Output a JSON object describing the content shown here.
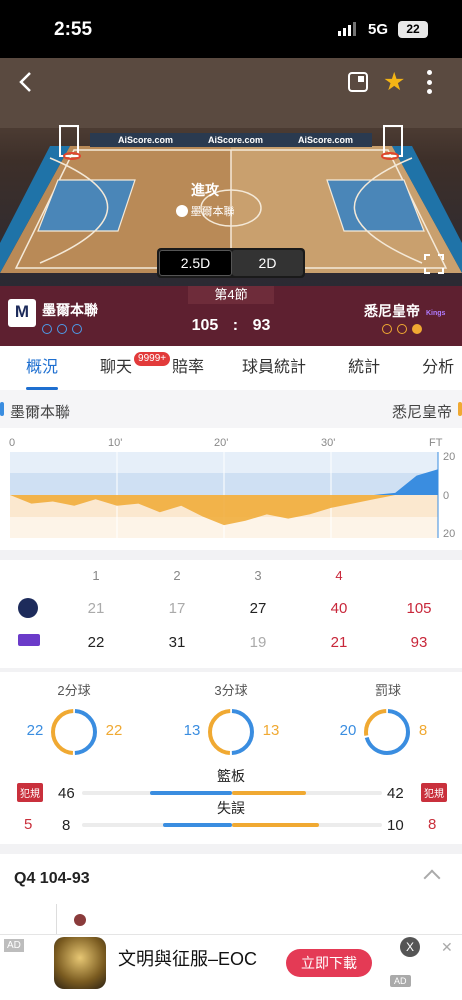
{
  "status_bar": {
    "time": "2:55",
    "network": "5G",
    "battery": "22"
  },
  "header": {
    "back_icon": "chevron-left-icon",
    "window_icon": "picture-in-picture-icon",
    "favorite_icon": "star-icon",
    "more_icon": "more-vertical-icon",
    "banner_text": [
      "AiScore.com",
      "AiScore.com",
      "AiScore.com"
    ],
    "possession_label": "進攻",
    "possession_team": "墨爾本聯",
    "view_modes": [
      "2.5D",
      "2D"
    ],
    "active_view": "2.5D",
    "fullscreen_icon": "fullscreen-icon"
  },
  "scoreboard": {
    "period": "第4節",
    "home": {
      "name": "墨爾本聯",
      "logo_text": "M",
      "score": "105",
      "timeouts": [
        "empty",
        "empty",
        "empty"
      ]
    },
    "away": {
      "name": "悉尼皇帝",
      "logo_text": "Kings",
      "score": "93",
      "timeouts": [
        "filled",
        "filled",
        "filled"
      ]
    },
    "separator": ":"
  },
  "tabs": [
    {
      "label": "概況",
      "active": true
    },
    {
      "label": "聊天",
      "badge": "9999+"
    },
    {
      "label": "賠率"
    },
    {
      "label": "球員統計"
    },
    {
      "label": "統計"
    },
    {
      "label": "分析"
    }
  ],
  "momentum": {
    "home_label": "墨爾本聯",
    "away_label": "悉尼皇帝",
    "x_labels": [
      "0",
      "10'",
      "20'",
      "30'",
      "FT"
    ],
    "y_labels": [
      "20",
      "0",
      "20"
    ],
    "colors": {
      "home": "#3a8de0",
      "away": "#f0a932"
    }
  },
  "chart_data": {
    "type": "area",
    "x": [
      0,
      2,
      4,
      6,
      8,
      10,
      12,
      14,
      16,
      18,
      20,
      22,
      24,
      26,
      28,
      30,
      32,
      34,
      36,
      38,
      40
    ],
    "values": [
      0,
      -4,
      -3,
      -5,
      -2,
      -5,
      -4,
      -8,
      -5,
      -10,
      -14,
      -12,
      -9,
      -11,
      -9,
      -6,
      -4,
      -2,
      1,
      9,
      12
    ],
    "xlim": [
      0,
      40
    ],
    "ylim": [
      -20,
      20
    ]
  },
  "quarters": {
    "headers": [
      "1",
      "2",
      "3",
      "4"
    ],
    "home": {
      "q": [
        "21",
        "17",
        "27",
        "40"
      ],
      "total": "105"
    },
    "away": {
      "q": [
        "22",
        "31",
        "19",
        "21"
      ],
      "total": "93"
    }
  },
  "shooting": [
    {
      "title": "2分球",
      "home": "22",
      "away": "22",
      "home_share": 0.5
    },
    {
      "title": "3分球",
      "home": "13",
      "away": "13",
      "home_share": 0.5
    },
    {
      "title": "罰球",
      "home": "20",
      "away": "8",
      "home_share": 0.714
    }
  ],
  "bars": [
    {
      "label": "籃板",
      "home": "46",
      "away": "42",
      "home_val": 46,
      "away_val": 42
    },
    {
      "label": "失誤",
      "home": "8",
      "away": "10",
      "home_val": 8,
      "away_val": 10
    }
  ],
  "fouls": {
    "label": "犯規",
    "home": "5",
    "away": "8"
  },
  "quarter_section": {
    "title": "Q4  104-93"
  },
  "ad": {
    "tag": "AD",
    "title": "文明與征服–EOC",
    "button": "立即下載",
    "close": "X",
    "logo": "AD"
  }
}
